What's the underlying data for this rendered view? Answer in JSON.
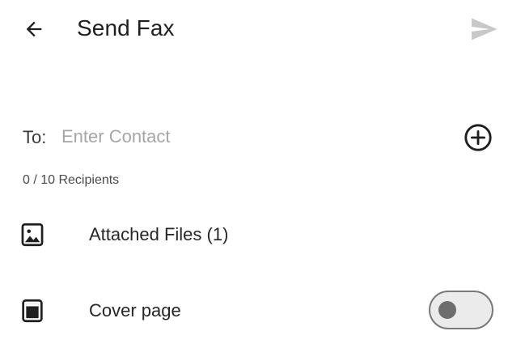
{
  "header": {
    "title": "Send Fax",
    "back_icon": "arrow-left-icon",
    "send_icon": "send-icon",
    "send_enabled": false
  },
  "recipient": {
    "label": "To:",
    "placeholder": "Enter Contact",
    "value": "",
    "add_icon": "plus-circle-icon",
    "count_text": "0 / 10 Recipients"
  },
  "attachments": {
    "icon": "image-file-icon",
    "label": "Attached Files (1)"
  },
  "cover_page": {
    "icon": "cover-page-icon",
    "label": "Cover page",
    "enabled": false
  },
  "colors": {
    "text_primary": "#1f1f1f",
    "placeholder": "#a6a6a6",
    "send_disabled": "#c8c8c8",
    "toggle_track": "#ebebeb",
    "toggle_border": "#7a7a7a"
  }
}
